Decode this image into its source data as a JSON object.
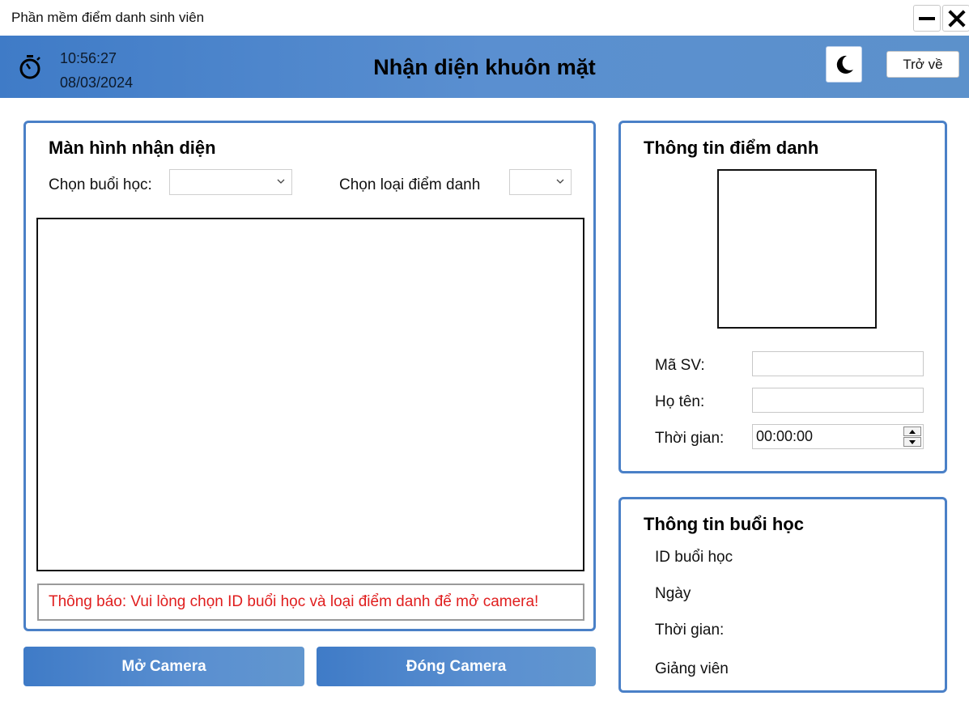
{
  "window": {
    "title": "Phần mềm điểm danh sinh viên"
  },
  "header": {
    "time": "10:56:27",
    "date": "08/03/2024",
    "title": "Nhận diện khuôn mặt",
    "back_label": "Trở về"
  },
  "recognition": {
    "title": "Màn hình nhận diện",
    "session_label": "Chọn buổi học:",
    "session_value": "",
    "type_label": "Chọn loại điểm danh",
    "type_value": "",
    "notice": "Thông báo: Vui lòng chọn ID buổi học và loại điểm danh để mở camera!"
  },
  "buttons": {
    "open_camera": "Mở Camera",
    "close_camera": "Đóng Camera"
  },
  "attendance_info": {
    "title": "Thông tin điểm danh",
    "student_id_label": "Mã SV:",
    "student_id_value": "",
    "name_label": "Họ tên:",
    "name_value": "",
    "time_label": "Thời gian:",
    "time_value": "00:00:00"
  },
  "session_info": {
    "title": "Thông tin buổi học",
    "id_label": "ID buổi học",
    "date_label": "Ngày",
    "time_label": "Thời gian:",
    "lecturer_label": "Giảng viên"
  },
  "colors": {
    "accent": "#4a80c7",
    "notice_text": "#e01e1e"
  },
  "icons": {
    "clock": "stopwatch-icon",
    "dark_mode": "moon-icon",
    "minimize": "minimize-icon",
    "close": "close-icon"
  }
}
